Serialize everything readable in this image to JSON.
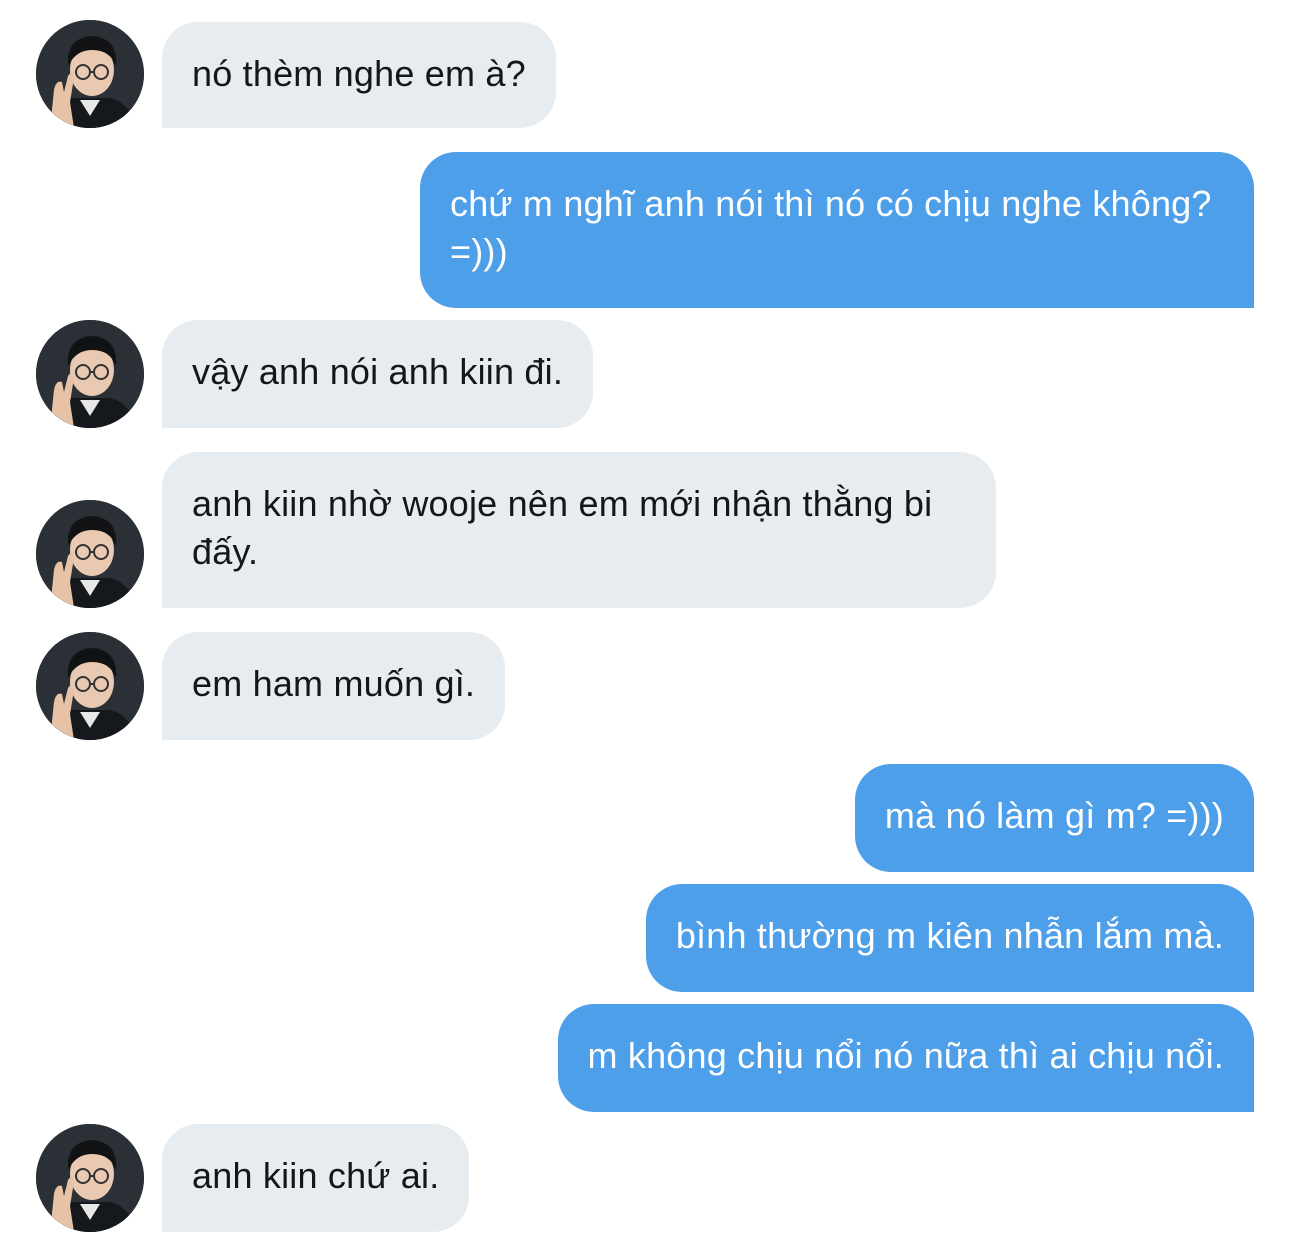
{
  "conversation": {
    "messages": [
      {
        "direction": "received",
        "text": "nó thèm nghe em à?"
      },
      {
        "direction": "sent",
        "text": "chứ m nghĩ anh nói thì nó có chịu nghe không? =)))"
      },
      {
        "direction": "received",
        "text": "vậy anh nói anh kiin đi."
      },
      {
        "direction": "received",
        "text": "anh kiin nhờ wooje nên em mới nhận thằng bi đấy."
      },
      {
        "direction": "received",
        "text": "em ham muốn gì."
      },
      {
        "direction": "sent",
        "text": "mà nó làm gì m? =)))"
      },
      {
        "direction": "sent",
        "text": "bình thường m kiên nhẫn lắm mà."
      },
      {
        "direction": "sent",
        "text": "m không chịu nổi nó nữa thì ai chịu nổi."
      },
      {
        "direction": "received",
        "text": "anh kiin chứ ai."
      }
    ]
  },
  "colors": {
    "sent_bubble": "#4e9fe9",
    "received_bubble": "#e6ecf0",
    "received_text": "#14171a",
    "sent_text": "#ffffff"
  },
  "icons": {
    "avatar": "contact-avatar-photo"
  }
}
